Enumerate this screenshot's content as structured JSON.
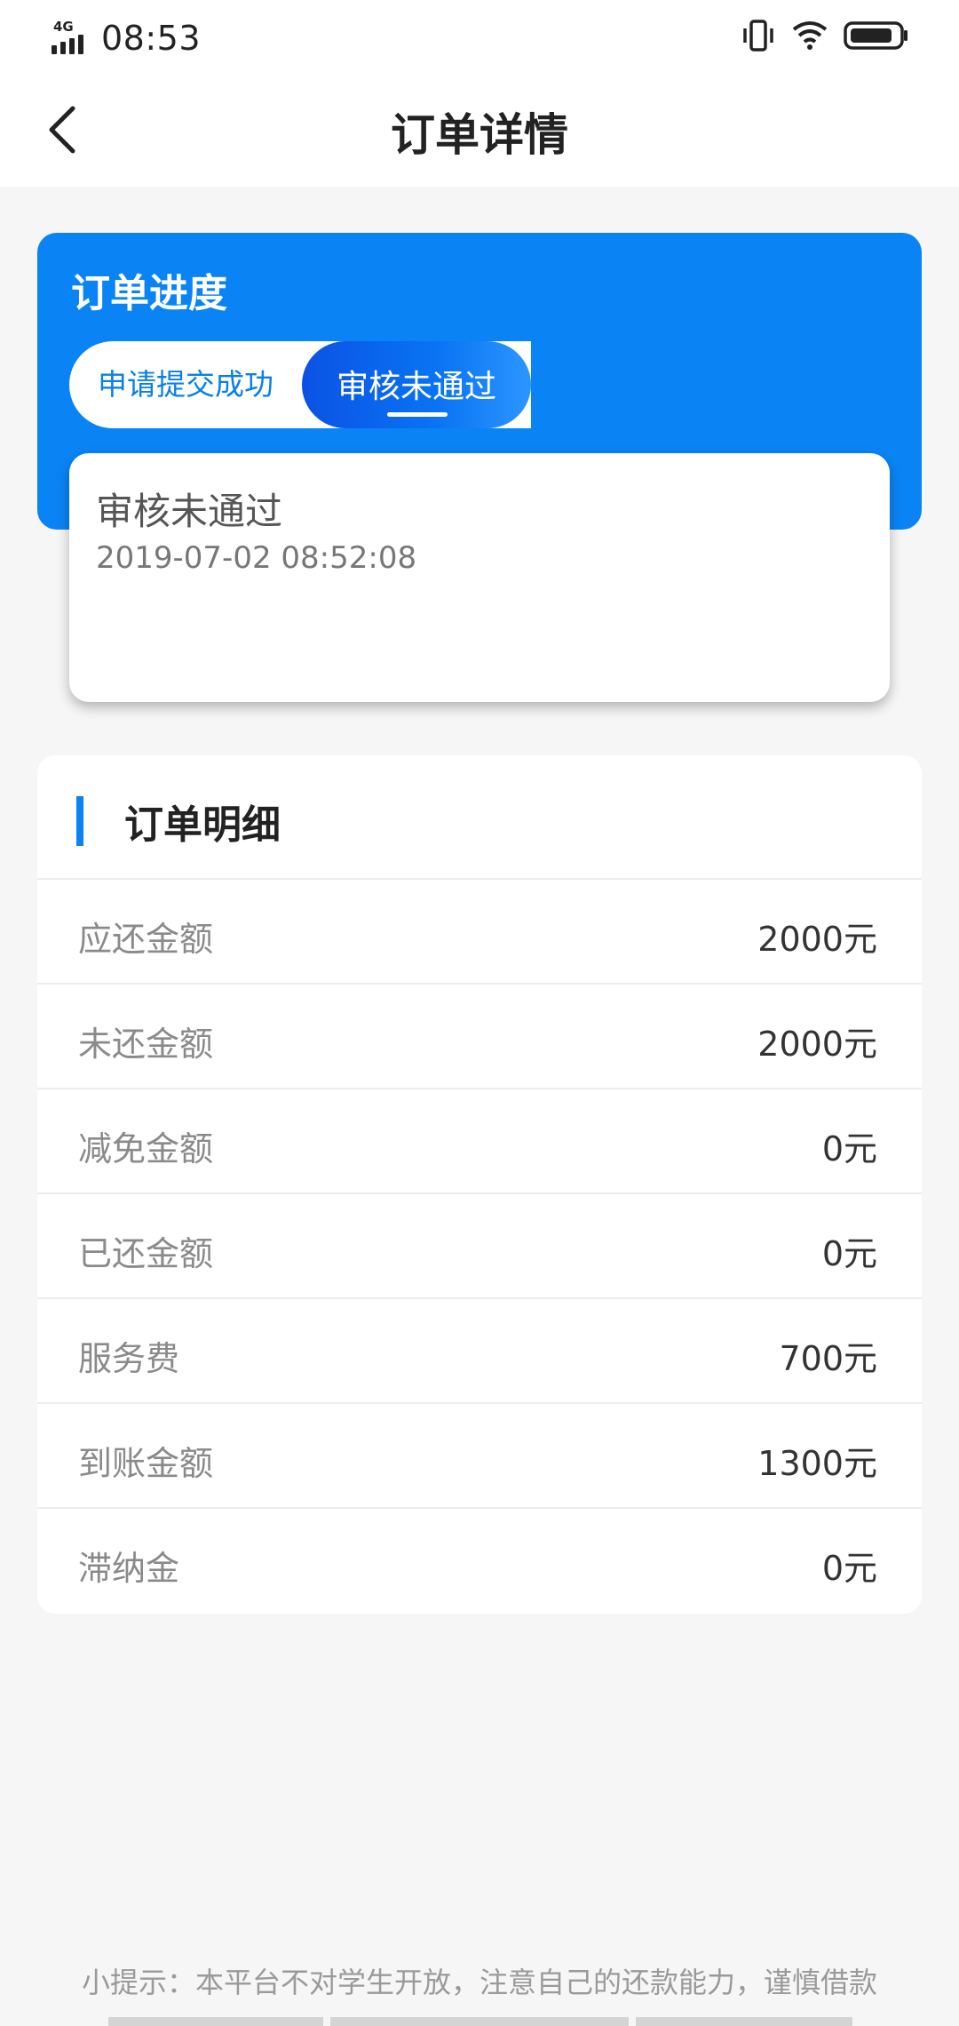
{
  "status_bar": {
    "network": "4G",
    "time": "08:53",
    "icons": [
      "signal-icon",
      "vibrate-icon",
      "wifi-icon",
      "battery-icon"
    ]
  },
  "navbar": {
    "back_icon": "chevron-left-icon",
    "title": "订单详情"
  },
  "progress": {
    "title": "订单进度",
    "steps": [
      {
        "label": "申请提交成功",
        "active": false
      },
      {
        "label": "审核未通过",
        "active": true
      }
    ],
    "current_status": {
      "title": "审核未通过",
      "time": "2019-07-02 08:52:08"
    }
  },
  "detail": {
    "title": "订单明细",
    "rows": [
      {
        "label": "应还金额",
        "value": "2000元"
      },
      {
        "label": "未还金额",
        "value": "2000元"
      },
      {
        "label": "减免金额",
        "value": "0元"
      },
      {
        "label": "已还金额",
        "value": "0元"
      },
      {
        "label": "服务费",
        "value": "700元"
      },
      {
        "label": "到账金额",
        "value": "1300元"
      },
      {
        "label": "滞纳金",
        "value": "0元"
      }
    ]
  },
  "tip": "小提示：本平台不对学生开放，注意自己的还款能力，谨慎借款",
  "colors": {
    "accent": "#0a84f5",
    "background": "#f6f6f6",
    "label_gray": "#8a8a8a"
  }
}
